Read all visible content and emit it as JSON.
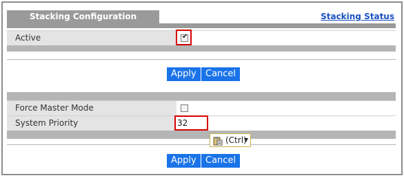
{
  "header": {
    "title": "Stacking Configuration",
    "status_link": "Stacking Status"
  },
  "section1": {
    "active_label": "Active",
    "active_checked": true,
    "apply_label": "Apply",
    "cancel_label": "Cancel"
  },
  "section2": {
    "force_master_label": "Force Master Mode",
    "force_master_checked": false,
    "priority_label": "System Priority",
    "priority_value": "32",
    "paste_label": "(Ctrl)",
    "apply_label": "Apply",
    "cancel_label": "Cancel"
  },
  "colors": {
    "button": "#1a73e8",
    "highlight": "#d60000",
    "link": "#1a52c4",
    "header_tab": "#9a9a9a"
  }
}
